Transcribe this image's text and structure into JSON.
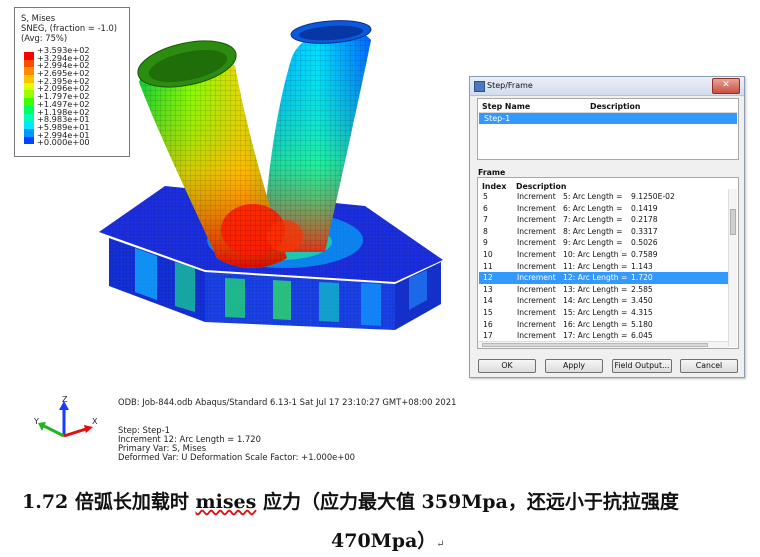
{
  "legend": {
    "line1": "S, Mises",
    "line2": "SNEG, (fraction = -1.0)",
    "line3": "(Avg: 75%)",
    "values": [
      "+3.593e+02",
      "+3.294e+02",
      "+2.994e+02",
      "+2.695e+02",
      "+2.395e+02",
      "+2.096e+02",
      "+1.797e+02",
      "+1.497e+02",
      "+1.198e+02",
      "+8.983e+01",
      "+5.989e+01",
      "+2.994e+01",
      "+0.000e+00"
    ],
    "colors": [
      "#ff0000",
      "#ff4a00",
      "#ff8c00",
      "#ffc400",
      "#e0ff00",
      "#98ff00",
      "#3dff00",
      "#00ff5a",
      "#00ffb4",
      "#00e8ff",
      "#0096ff",
      "#0044ff",
      "#0000ff"
    ]
  },
  "dialog": {
    "title": "Step/Frame",
    "close": "✕",
    "step_name_header": "Step Name",
    "description_header": "Description",
    "step_row": "Step-1",
    "frame_label": "Frame",
    "index_header": "Index",
    "frame_desc_header": "Description",
    "frames": [
      {
        "index": "5",
        "type": "Increment",
        "desc": "5: Arc Length =",
        "value": "9.1250E-02"
      },
      {
        "index": "6",
        "type": "Increment",
        "desc": "6: Arc Length =",
        "value": "0.1419"
      },
      {
        "index": "7",
        "type": "Increment",
        "desc": "7: Arc Length =",
        "value": "0.2178"
      },
      {
        "index": "8",
        "type": "Increment",
        "desc": "8: Arc Length =",
        "value": "0.3317"
      },
      {
        "index": "9",
        "type": "Increment",
        "desc": "9: Arc Length =",
        "value": "0.5026"
      },
      {
        "index": "10",
        "type": "Increment",
        "desc": "10: Arc Length =",
        "value": "0.7589"
      },
      {
        "index": "11",
        "type": "Increment",
        "desc": "11: Arc Length =",
        "value": "1.143"
      },
      {
        "index": "12",
        "type": "Increment",
        "desc": "12: Arc Length =",
        "value": "1.720",
        "selected": true
      },
      {
        "index": "13",
        "type": "Increment",
        "desc": "13: Arc Length =",
        "value": "2.585"
      },
      {
        "index": "14",
        "type": "Increment",
        "desc": "14: Arc Length =",
        "value": "3.450"
      },
      {
        "index": "15",
        "type": "Increment",
        "desc": "15: Arc Length =",
        "value": "4.315"
      },
      {
        "index": "16",
        "type": "Increment",
        "desc": "16: Arc Length =",
        "value": "5.180"
      },
      {
        "index": "17",
        "type": "Increment",
        "desc": "17: Arc Length =",
        "value": "6.045"
      }
    ],
    "buttons": {
      "ok": "OK",
      "apply": "Apply",
      "field_output": "Field Output...",
      "cancel": "Cancel"
    }
  },
  "triad": {
    "z": "Z",
    "y": "Y",
    "x": "X"
  },
  "info": {
    "odb_line": "ODB: Job-844.odb    Abaqus/Standard 6.13-1    Sat Jul 17 23:10:27 GMT+08:00 2021",
    "step_line": "Step: Step-1",
    "increment_line": "Increment     12: Arc Length =    1.720",
    "primary_line": "Primary Var: S, Mises",
    "deformed_line": "Deformed Var: U   Deformation Scale Factor: +1.000e+00"
  },
  "caption": {
    "part1": "1.72 倍弧长加载时 ",
    "mises": "mises",
    "part2": " 应力（应力最大值 359Mpa，还远小于抗拉强度",
    "line2": "470Mpa）",
    "para_mark": "↵"
  }
}
